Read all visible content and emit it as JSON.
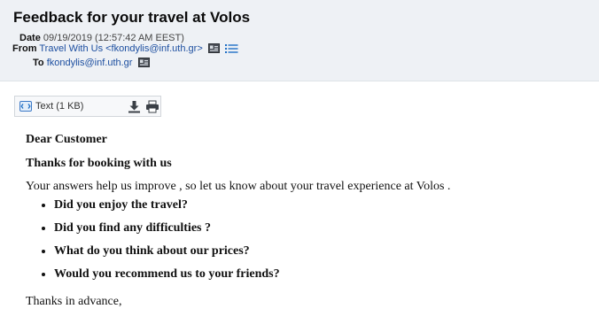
{
  "email": {
    "subject": "Feedback for your travel at Volos",
    "date_label": "Date",
    "date_value": "09/19/2019 (12:57:42 AM EEST)",
    "from_label": "From",
    "from_value": "Travel With Us <fkondylis@inf.uth.gr>",
    "to_label": "To",
    "to_value": "fkondylis@inf.uth.gr"
  },
  "attachment": {
    "label": "Text (1 KB)",
    "icons": [
      "text-icon",
      "download-icon",
      "print-icon"
    ]
  },
  "message": {
    "greeting": "Dear Customer",
    "thanks": "Thanks for booking with us",
    "intro": "Your answers help us improve , so let us know about your travel experience at Volos .",
    "questions": [
      "Did you enjoy the travel?",
      "Did you find any difficulties ?",
      "What do you think about our prices?",
      "Would you recommend us to your friends?"
    ],
    "closing": "Thanks in advance,"
  },
  "colors": {
    "header_bg": "#eef1f5",
    "link": "#1d4fa0",
    "icon_blue": "#1f6fc5"
  }
}
